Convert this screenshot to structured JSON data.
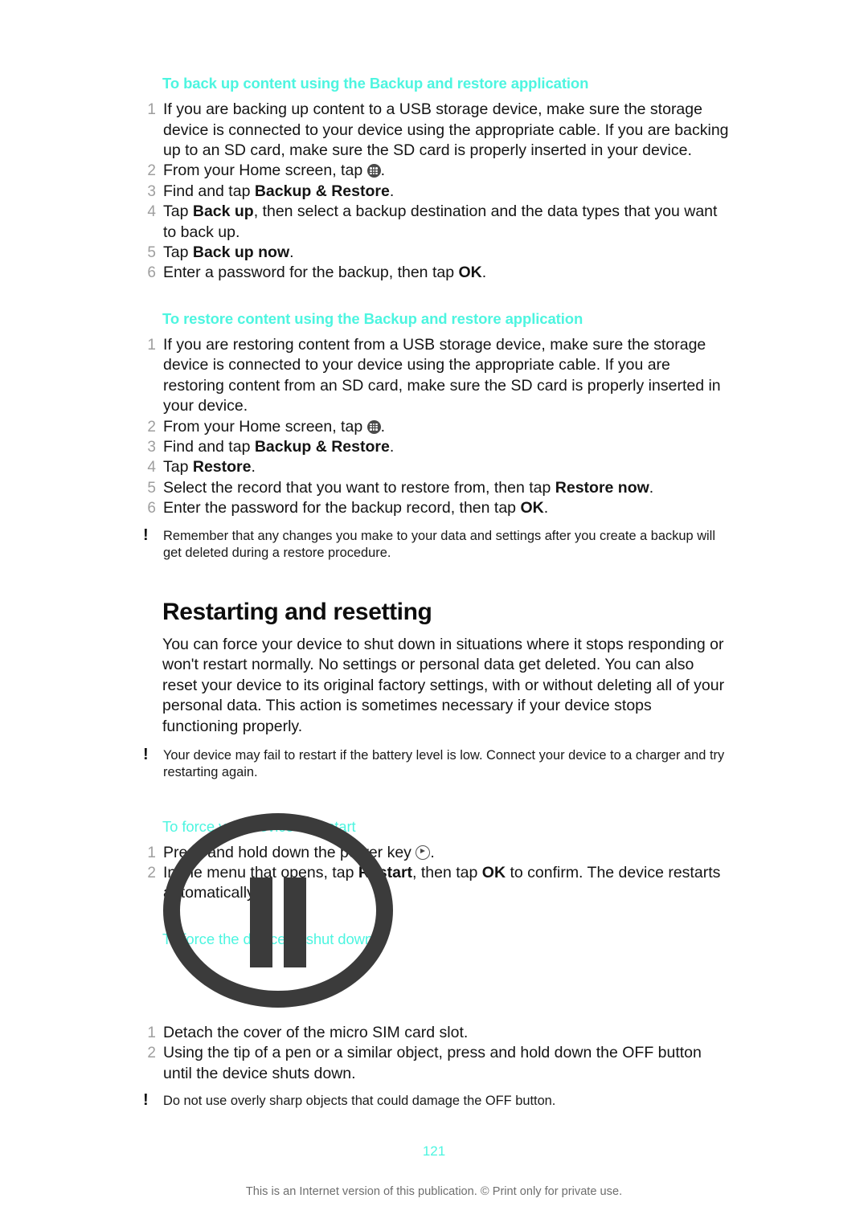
{
  "page": {
    "number": "121",
    "footer_note": "This is an Internet version of this publication. © Print only for private use."
  },
  "sections": {
    "backup": {
      "heading": "To back up content using the Backup and restore application",
      "steps": [
        {
          "num": "1",
          "text": "If you are backing up content to a USB storage device, make sure the storage device is connected to your device using the appropriate cable. If you are backing up to an SD card, make sure the SD card is properly inserted in your device."
        },
        {
          "num": "2",
          "pre": "From your Home screen, tap ",
          "icon": "app-drawer-icon",
          "post": "."
        },
        {
          "num": "3",
          "pre": "Find and tap ",
          "bold": "Backup & Restore",
          "post": "."
        },
        {
          "num": "4",
          "pre": "Tap ",
          "bold": "Back up",
          "post": ", then select a backup destination and the data types that you want to back up."
        },
        {
          "num": "5",
          "pre": "Tap ",
          "bold": "Back up now",
          "post": "."
        },
        {
          "num": "6",
          "pre": "Enter a password for the backup, then tap ",
          "bold": "OK",
          "post": "."
        }
      ]
    },
    "restore": {
      "heading": "To restore content using the Backup and restore application",
      "steps": [
        {
          "num": "1",
          "text": "If you are restoring content from a USB storage device, make sure the storage device is connected to your device using the appropriate cable. If you are restoring content from an SD card, make sure the SD card is properly inserted in your device."
        },
        {
          "num": "2",
          "pre": "From your Home screen, tap ",
          "icon": "app-drawer-icon",
          "post": "."
        },
        {
          "num": "3",
          "pre": "Find and tap ",
          "bold": "Backup & Restore",
          "post": "."
        },
        {
          "num": "4",
          "pre": "Tap ",
          "bold": "Restore",
          "post": "."
        },
        {
          "num": "5",
          "pre": "Select the record that you want to restore from, then tap ",
          "bold": "Restore now",
          "post": "."
        },
        {
          "num": "6",
          "pre": "Enter the password for the backup record, then tap ",
          "bold": "OK",
          "post": "."
        }
      ],
      "note": "Remember that any changes you make to your data and settings after you create a backup will get deleted during a restore procedure."
    },
    "restarting": {
      "heading": "Restarting and resetting",
      "body": "You can force your device to shut down in situations where it stops responding or won't restart normally. No settings or personal data get deleted. You can also reset your device to its original factory settings, with or without deleting all of your personal data. This action is sometimes necessary if your device stops functioning properly.",
      "note": "Your device may fail to restart if the battery level is low. Connect your device to a charger and try restarting again."
    },
    "force_restart": {
      "heading": "To force your device to restart",
      "steps": [
        {
          "num": "1",
          "pre": "Press and hold down the power key ",
          "icon": "power-key-icon",
          "post": "."
        },
        {
          "num": "2",
          "pre": "In the menu that opens, tap ",
          "bold": "Restart",
          "mid": ", then tap ",
          "bold2": "OK",
          "post": " to confirm. The device restarts automatically."
        }
      ]
    },
    "force_shutdown": {
      "heading": "To force the device to shut down",
      "figure_icon": "pause-in-circle-icon",
      "steps": [
        {
          "num": "1",
          "text": "Detach the cover of the micro SIM card slot."
        },
        {
          "num": "2",
          "text": "Using the tip of a pen or a similar object, press and hold down the OFF button until the device shuts down."
        }
      ],
      "note": "Do not use overly sharp objects that could damage the OFF button."
    }
  },
  "colors": {
    "accent": "#4df5e0",
    "text": "#141414",
    "step_number": "#9e9e9e",
    "figure": "#3b3b3b",
    "footer": "#6e6e6e"
  }
}
